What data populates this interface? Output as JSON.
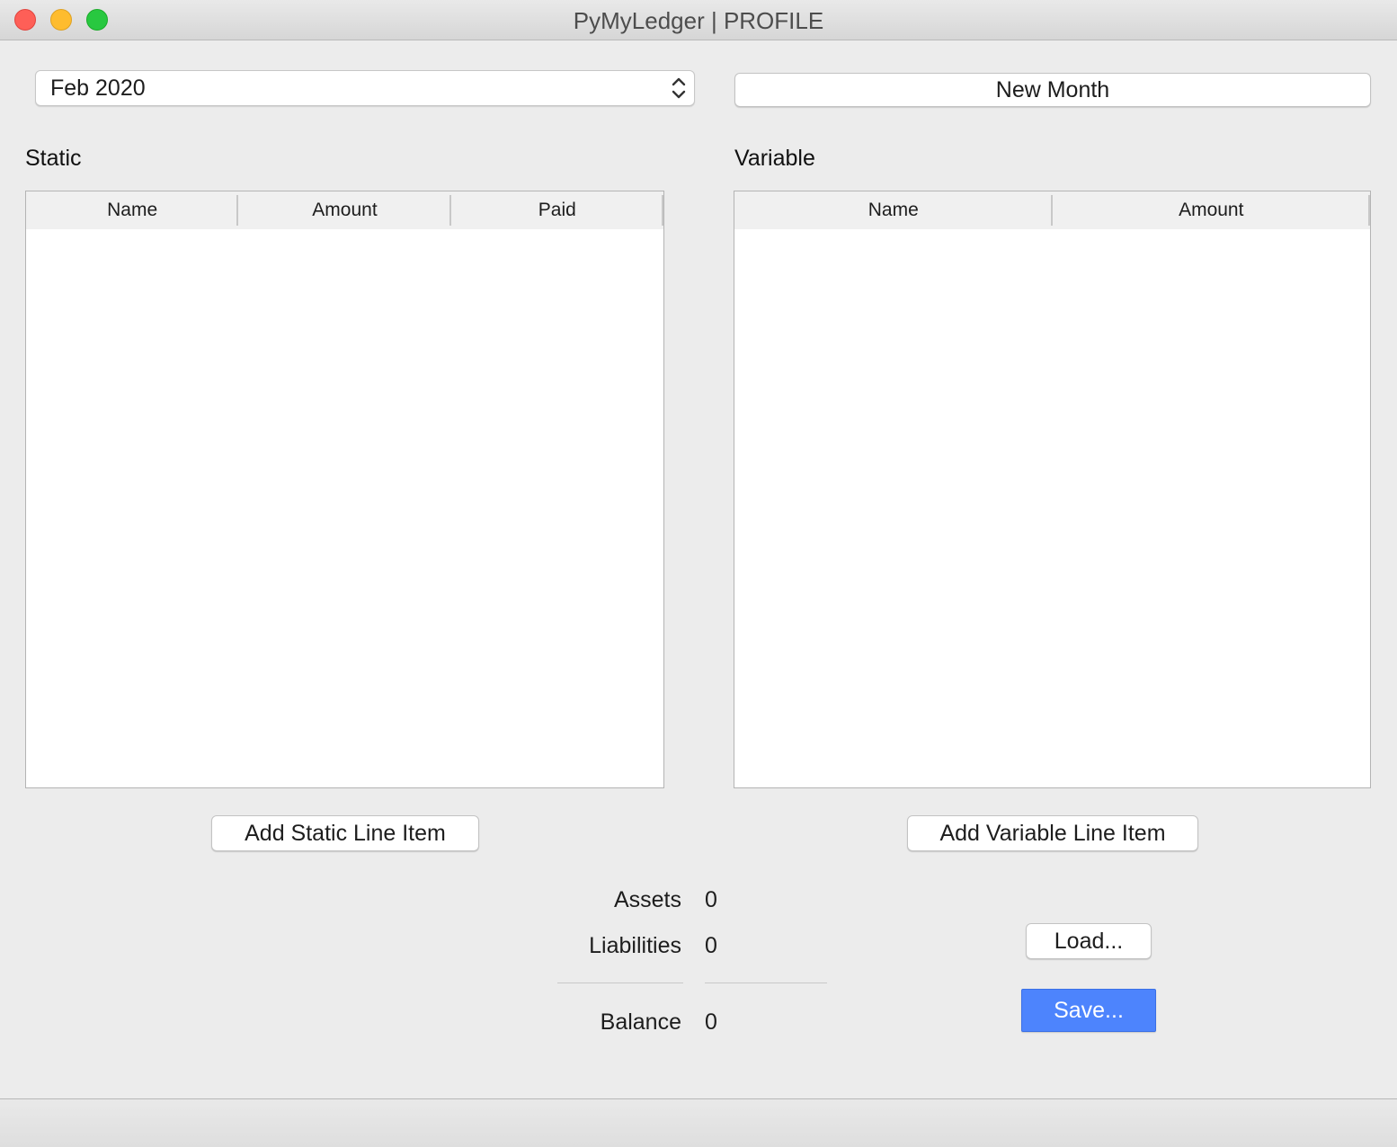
{
  "window": {
    "title": "PyMyLedger | PROFILE"
  },
  "month_select": {
    "value": "Feb 2020"
  },
  "buttons": {
    "new_month": "New Month",
    "add_static": "Add Static Line Item",
    "add_variable": "Add Variable Line Item",
    "load": "Load...",
    "save": "Save..."
  },
  "static_section": {
    "label": "Static",
    "columns": [
      "Name",
      "Amount",
      "Paid"
    ],
    "rows": []
  },
  "variable_section": {
    "label": "Variable",
    "columns": [
      "Name",
      "Amount"
    ],
    "rows": []
  },
  "summary": {
    "assets_label": "Assets",
    "assets_value": "0",
    "liabilities_label": "Liabilities",
    "liabilities_value": "0",
    "balance_label": "Balance",
    "balance_value": "0"
  },
  "colors": {
    "primary_button": "#4d84fd",
    "close": "#fe5f57",
    "minimize": "#febc2e",
    "zoom": "#28c840"
  }
}
